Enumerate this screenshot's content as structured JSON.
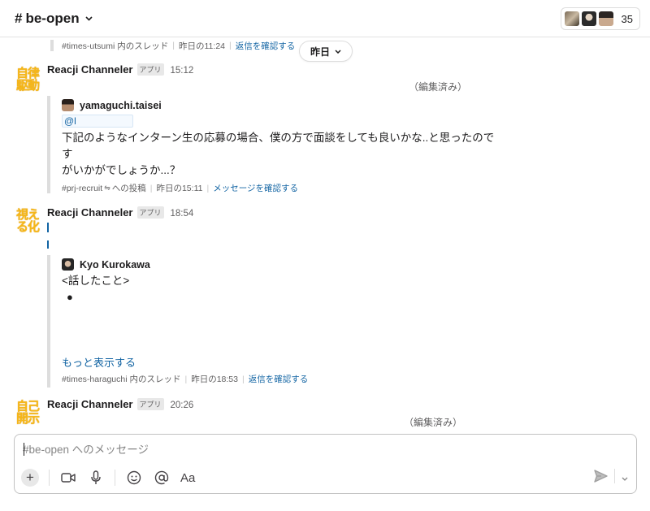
{
  "header": {
    "channel_name": "be-open",
    "hash": "#",
    "member_count": "35"
  },
  "date_divider": {
    "label": "昨日"
  },
  "top_thread_ref": {
    "thread": "#times-utsumi 内のスレッド",
    "time": "昨日の11:24",
    "link": "返信を確認する"
  },
  "messages": [
    {
      "emoji_lines": [
        "自律",
        "駆動"
      ],
      "sender": "Reacji Channeler",
      "badge": "アプリ",
      "time": "15:12",
      "edited": "（編集済み）",
      "quote": {
        "author": "yamaguchi.taisei",
        "mention": "@l",
        "lines": [
          "下記のようなインターン生の応募の場合、僕の方で面談をしても良いかな..と思ったのです",
          "がいかがでしょうか...？"
        ],
        "footer": {
          "source": "#prj-recruit",
          "source_suffix": "への投稿",
          "time": "昨日の15:11",
          "link": "メッセージを確認する"
        }
      }
    },
    {
      "emoji_lines": [
        "視え",
        "る化"
      ],
      "sender": "Reacji Channeler",
      "badge": "アプリ",
      "time": "18:54",
      "quote": {
        "author": "Kyo Kurokawa",
        "lines": [
          "<話したこと>"
        ],
        "bullet": "●",
        "more": "もっと表示する",
        "footer": {
          "source": "#times-haraguchi 内のスレッド",
          "time": "昨日の18:53",
          "link": "返信を確認する"
        }
      }
    },
    {
      "emoji_lines": [
        "自己",
        "開示"
      ],
      "sender": "Reacji Channeler",
      "badge": "アプリ",
      "time": "20:26",
      "edited": "（編集済み）"
    }
  ],
  "composer": {
    "placeholder": "#be-open へのメッセージ",
    "format_label": "Aa"
  },
  "colors": {
    "link": "#1264a3",
    "emoji": "#f6b719",
    "muted": "#616061"
  }
}
